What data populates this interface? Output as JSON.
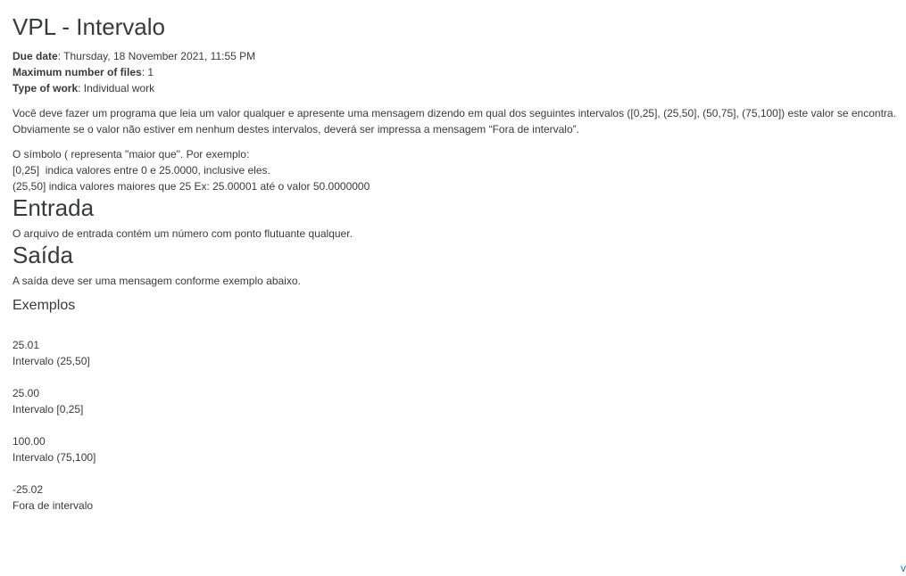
{
  "page": {
    "title": "VPL - Intervalo"
  },
  "meta": {
    "due_date_label": "Due date",
    "due_date_value": ": Thursday, 18 November 2021, 11:55 PM",
    "max_files_label": "Maximum number of files",
    "max_files_value": ": 1",
    "type_label": "Type of work",
    "type_value": ": Individual work"
  },
  "description": {
    "paragraph_1": "Você deve fazer um programa que leia um valor qualquer e apresente uma mensagem dizendo em qual dos seguintes intervalos ([0,25], (25,50], (50,75], (75,100]) este valor se encontra. Obviamente se o valor não estiver em nenhum destes intervalos, deverá ser impressa a mensagem “Fora de intervalo”.",
    "paragraph_2_line_1": "O símbolo ( representa \"maior que\". Por exemplo:",
    "paragraph_2_line_2": "[0,25]  indica valores entre 0 e 25.0000, inclusive eles.",
    "paragraph_2_line_3": "(25,50] indica valores maiores que 25 Ex: 25.00001 até o valor 50.0000000"
  },
  "entrada": {
    "heading": "Entrada",
    "text": "O arquivo de entrada contém um número com ponto flutuante qualquer."
  },
  "saida": {
    "heading": "Saída",
    "text": "A saída deve ser uma mensagem conforme exemplo abaixo."
  },
  "examples": {
    "heading": "Exemplos",
    "items": [
      {
        "input": "25.01",
        "output": "Intervalo (25,50]"
      },
      {
        "input": "25.00",
        "output": "Intervalo [0,25]"
      },
      {
        "input": "100.00",
        "output": "Intervalo (75,100]"
      },
      {
        "input": "-25.02",
        "output": "Fora de intervalo"
      }
    ]
  },
  "corner": {
    "glyph": "v",
    "color": "#0f6fc5"
  }
}
